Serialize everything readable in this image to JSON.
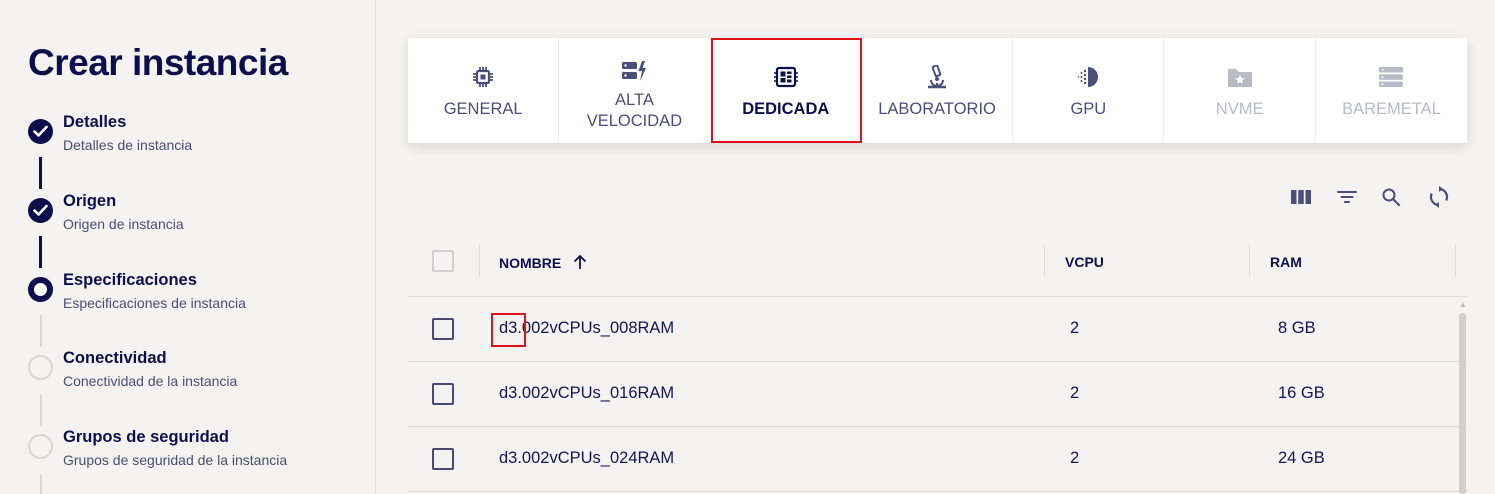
{
  "sidebar": {
    "title": "Crear instancia",
    "steps": [
      {
        "title": "Detalles",
        "subtitle": "Detalles de instancia",
        "status": "done"
      },
      {
        "title": "Origen",
        "subtitle": "Origen de instancia",
        "status": "done"
      },
      {
        "title": "Especificaciones",
        "subtitle": "Especificaciones de instancia",
        "status": "active"
      },
      {
        "title": "Conectividad",
        "subtitle": "Conectividad de la instancia",
        "status": "todo"
      },
      {
        "title": "Grupos de seguridad",
        "subtitle": "Grupos de seguridad de la instancia",
        "status": "todo"
      }
    ]
  },
  "tabs": [
    {
      "label": "GENERAL",
      "icon": "chip-icon",
      "state": "enabled"
    },
    {
      "label": "ALTA VELOCIDAD",
      "icon": "server-bolt-icon",
      "state": "enabled"
    },
    {
      "label": "DEDICADA",
      "icon": "dedicated-chip-icon",
      "state": "selected"
    },
    {
      "label": "LABORATORIO",
      "icon": "microscope-icon",
      "state": "enabled"
    },
    {
      "label": "GPU",
      "icon": "gpu-icon",
      "state": "enabled"
    },
    {
      "label": "NVME",
      "icon": "folder-star-icon",
      "state": "disabled"
    },
    {
      "label": "BAREMETAL",
      "icon": "server-stack-icon",
      "state": "disabled"
    }
  ],
  "toolbar": {
    "icons": [
      "columns-icon",
      "filter-icon",
      "search-icon",
      "refresh-icon"
    ]
  },
  "table": {
    "headers": {
      "name": "NOMBRE",
      "vcpu": "VCPU",
      "ram": "RAM"
    },
    "sort": "ascending",
    "rows": [
      {
        "name": "d3.002vCPUs_008RAM",
        "vcpu": "2",
        "ram": "8 GB"
      },
      {
        "name": "d3.002vCPUs_016RAM",
        "vcpu": "2",
        "ram": "16 GB"
      },
      {
        "name": "d3.002vCPUs_024RAM",
        "vcpu": "2",
        "ram": "24 GB"
      }
    ]
  },
  "colors": {
    "primary": "#0d0f4c",
    "highlight": "#e0121a",
    "background": "#f4f3f1",
    "disabled": "#b9bac4"
  }
}
